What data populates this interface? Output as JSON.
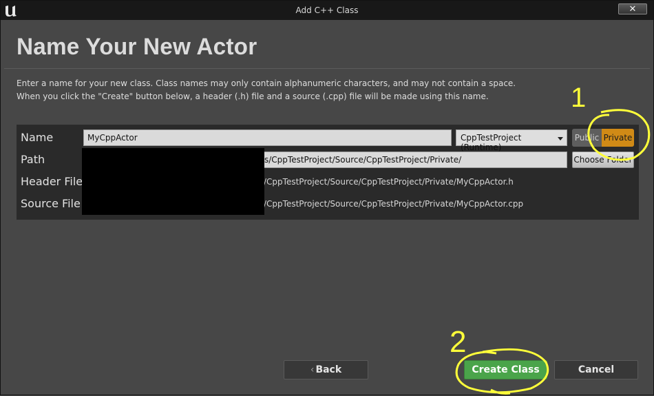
{
  "window": {
    "title": "Add C++ Class",
    "close_label": "✕"
  },
  "heading": "Name Your New Actor",
  "description": {
    "line1": "Enter a name for your new class. Class names may only contain alphanumeric characters, and may not contain a space.",
    "line2": "When you click the \"Create\" button below, a header (.h) file and a source (.cpp) file will be made using this name."
  },
  "form": {
    "name_label": "Name",
    "name_value": "MyCppActor",
    "module_selected": "CppTestProject (Runtime)",
    "public_label": "Public",
    "private_label": "Private",
    "path_label": "Path",
    "path_value": "s/CppTestProject/Source/CppTestProject/Private/",
    "choose_folder_label": "Choose Folder",
    "header_label": "Header File",
    "header_value": "/CppTestProject/Source/CppTestProject/Private/MyCppActor.h",
    "source_label": "Source File",
    "source_value": "/CppTestProject/Source/CppTestProject/Private/MyCppActor.cpp"
  },
  "buttons": {
    "back": "Back",
    "create": "Create Class",
    "cancel": "Cancel"
  },
  "annotations": {
    "step1": "1",
    "step2": "2"
  },
  "colors": {
    "private_active": "#d08a16",
    "create_green": "#4aa44a",
    "annotation_yellow": "#ffff3a"
  }
}
